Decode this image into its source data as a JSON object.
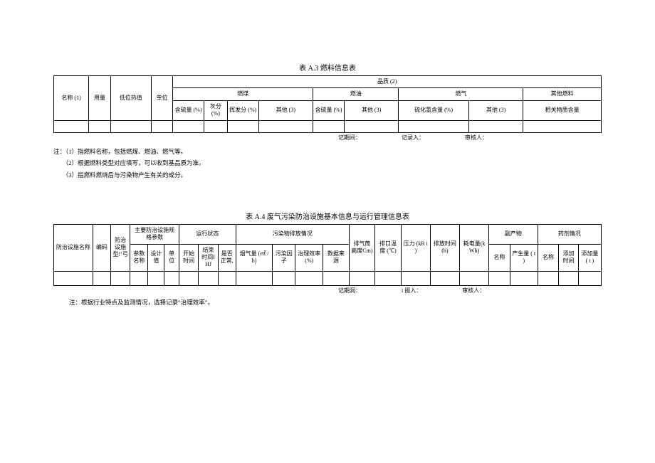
{
  "table_a3": {
    "title": "表 A.3 燃料信息表",
    "headers": {
      "name": "名称 (1)",
      "usage": "用量",
      "low_heat": "低位热值",
      "unit": "单位",
      "quality": "品质 (2)",
      "coal": "燃煤",
      "oil": "燃油",
      "gas": "燃气",
      "other_fuel": "其他燃料",
      "sulfur": "含硫量 (%)",
      "ash": "灰分 (%)",
      "volatile": "挥发分 (%)",
      "other3": "其他 (3)",
      "oil_sulfur": "含硫量 (%)",
      "oil_other": "其他 (3)",
      "h2s": "硫化氢含量 (%)",
      "gas_other": "其他 (3)",
      "related": "相关物质含量"
    },
    "footer": {
      "period": "记期间：",
      "recorder": "记录入：",
      "reviewer": "审核人："
    },
    "notes": {
      "prefix": "注：",
      "n1": "（1）指燃料名称，包括燃煤、燃油、燃气等。",
      "n2": "（2）根据燃料类型对应填写，可以收到基品质为准。",
      "n3": "（3）指燃料燃烧后与污染物产生有关的成分。"
    }
  },
  "table_a4": {
    "title": "表 A.4 废气污染防治设施基本信息与运行管理信息表",
    "headers": {
      "facility_name": "防治设施名称",
      "code": "编码",
      "facility_type": "防治设施型!‘弓",
      "main_params": "主要防治设施规格参数",
      "param_name": "参数名称",
      "design_val": "设计值",
      "unit": "单位",
      "run_status": "运行状态",
      "start_time": "开始时间",
      "end_time": "结束时间IHJ",
      "is_normal": "是否正常,",
      "pollutant_emission": "污染物排放情况",
      "smoke_vol": "烟气量\n(㎡ / h)",
      "pollution_factor": "污染因子",
      "treat_eff": "治理效率(%)",
      "data_source": "数据来源",
      "stack_height": "排气筒高度Cm)",
      "outlet_temp": "排口温度 (℃)",
      "pressure": "压力\n(kR i )",
      "emit_time": "排放时间(h)",
      "power": "耗电量(kWh)",
      "byproduct": "副产物",
      "bp_name": "名称",
      "bp_amount": "产生量\n( t )",
      "reagent": "药剂情况",
      "re_name": "名称",
      "add_time": "添加时间",
      "add_amount": "添加量\n( t )"
    },
    "footer": {
      "period": "记期洞：",
      "recorder": "i 掇入：",
      "reviewer": "审核人："
    },
    "note": "注：根据行业特点及监测情况，选择记录“治理效率”。"
  }
}
